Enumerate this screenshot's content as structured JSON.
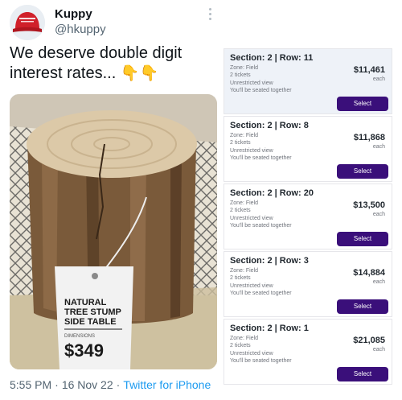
{
  "user": {
    "name": "Kuppy",
    "handle": "@hkuppy"
  },
  "tweet": {
    "text": "We deserve double digit interest rates...",
    "emoji": "👇👇"
  },
  "photo": {
    "tag_title": "NATURAL TREE STUMP SIDE TABLE",
    "tag_small": "DIMENSIONS",
    "tag_price": "$349"
  },
  "meta": {
    "time": "5:55 PM",
    "separator": "·",
    "date": "16 Nov 22",
    "source": "Twitter for iPhone"
  },
  "listings": [
    {
      "section": "Section: 2 | Row: 11",
      "zone": "Zone: Field",
      "tickets": "2 tickets",
      "view": "Unrestricted view",
      "seating": "You'll be seated together",
      "price": "$11,461",
      "each": "each",
      "button": "Select",
      "selected": true
    },
    {
      "section": "Section: 2 | Row: 8",
      "zone": "Zone: Field",
      "tickets": "2 tickets",
      "view": "Unrestricted view",
      "seating": "You'll be seated together",
      "price": "$11,868",
      "each": "each",
      "button": "Select",
      "selected": false
    },
    {
      "section": "Section: 2 | Row: 20",
      "zone": "Zone: Field",
      "tickets": "2 tickets",
      "view": "Unrestricted view",
      "seating": "You'll be seated together",
      "price": "$13,500",
      "each": "each",
      "button": "Select",
      "selected": false
    },
    {
      "section": "Section: 2 | Row: 3",
      "zone": "Zone: Field",
      "tickets": "2 tickets",
      "view": "Unrestricted view",
      "seating": "You'll be seated together",
      "price": "$14,884",
      "each": "each",
      "button": "Select",
      "selected": false
    },
    {
      "section": "Section: 2 | Row: 1",
      "zone": "Zone: Field",
      "tickets": "2 tickets",
      "view": "Unrestricted view",
      "seating": "You'll be seated together",
      "price": "$21,085",
      "each": "each",
      "button": "Select",
      "selected": false
    }
  ]
}
